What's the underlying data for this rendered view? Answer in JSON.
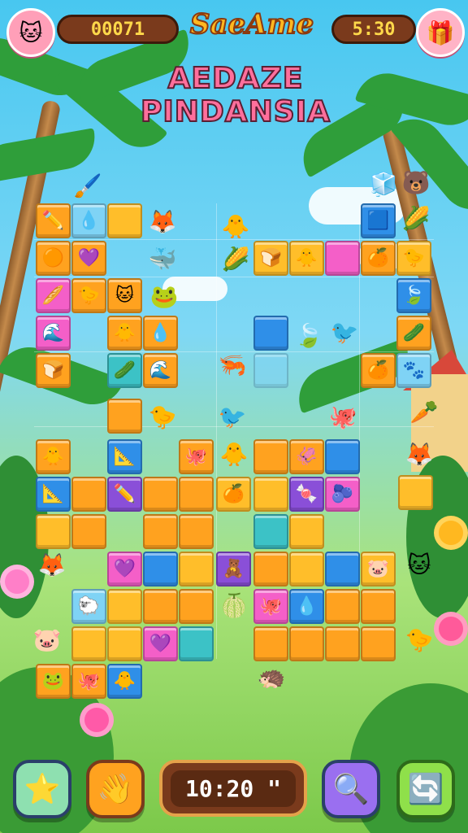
{
  "hud": {
    "score": "00071",
    "game_title": "SaeAme",
    "level_name": "AEDAZE PINDANSIA",
    "clock": "5:30",
    "player_avatar_icon": "cat-face-icon",
    "gift_icon": "gift-box-icon"
  },
  "bottom_bar": {
    "timer": "10:20 \"",
    "buttons": [
      {
        "id": "star",
        "icon": "star-icon"
      },
      {
        "id": "hint",
        "icon": "hand-icon"
      },
      {
        "id": "search",
        "icon": "magnifier-icon"
      },
      {
        "id": "refresh",
        "icon": "refresh-icon"
      }
    ]
  },
  "colors": {
    "orange": "#ffa21f",
    "amber": "#ffbe2a",
    "blue": "#2f8fe8",
    "pink": "#f45fc8",
    "purple": "#8a4fd8",
    "teal": "#3cc2c6",
    "light_blue": "#7fd3f5"
  }
}
